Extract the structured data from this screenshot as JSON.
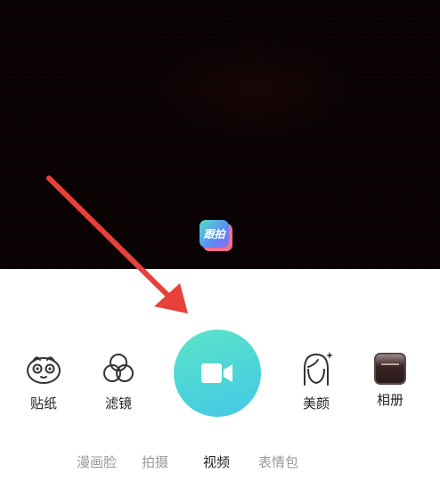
{
  "preview": {
    "follow_badge_label": "跟拍"
  },
  "toolbar": {
    "left_items": [
      {
        "label": "贴纸",
        "icon": "sticker-face-icon"
      },
      {
        "label": "滤镜",
        "icon": "filter-circles-icon"
      }
    ],
    "right_items": [
      {
        "label": "美颜",
        "icon": "beauty-face-icon"
      },
      {
        "label": "相册",
        "icon": "album-thumbnail-icon"
      }
    ],
    "record_icon": "video-camera-icon",
    "record_colors": [
      "#5fe3c8",
      "#45c7e8"
    ]
  },
  "mode_tabs": {
    "items": [
      "漫画脸",
      "拍摄",
      "视频",
      "表情包"
    ],
    "active": "视频"
  },
  "colors": {
    "arrow": "#e8403a",
    "active_tab": "#222222",
    "inactive_tab": "#9a9a9a"
  }
}
